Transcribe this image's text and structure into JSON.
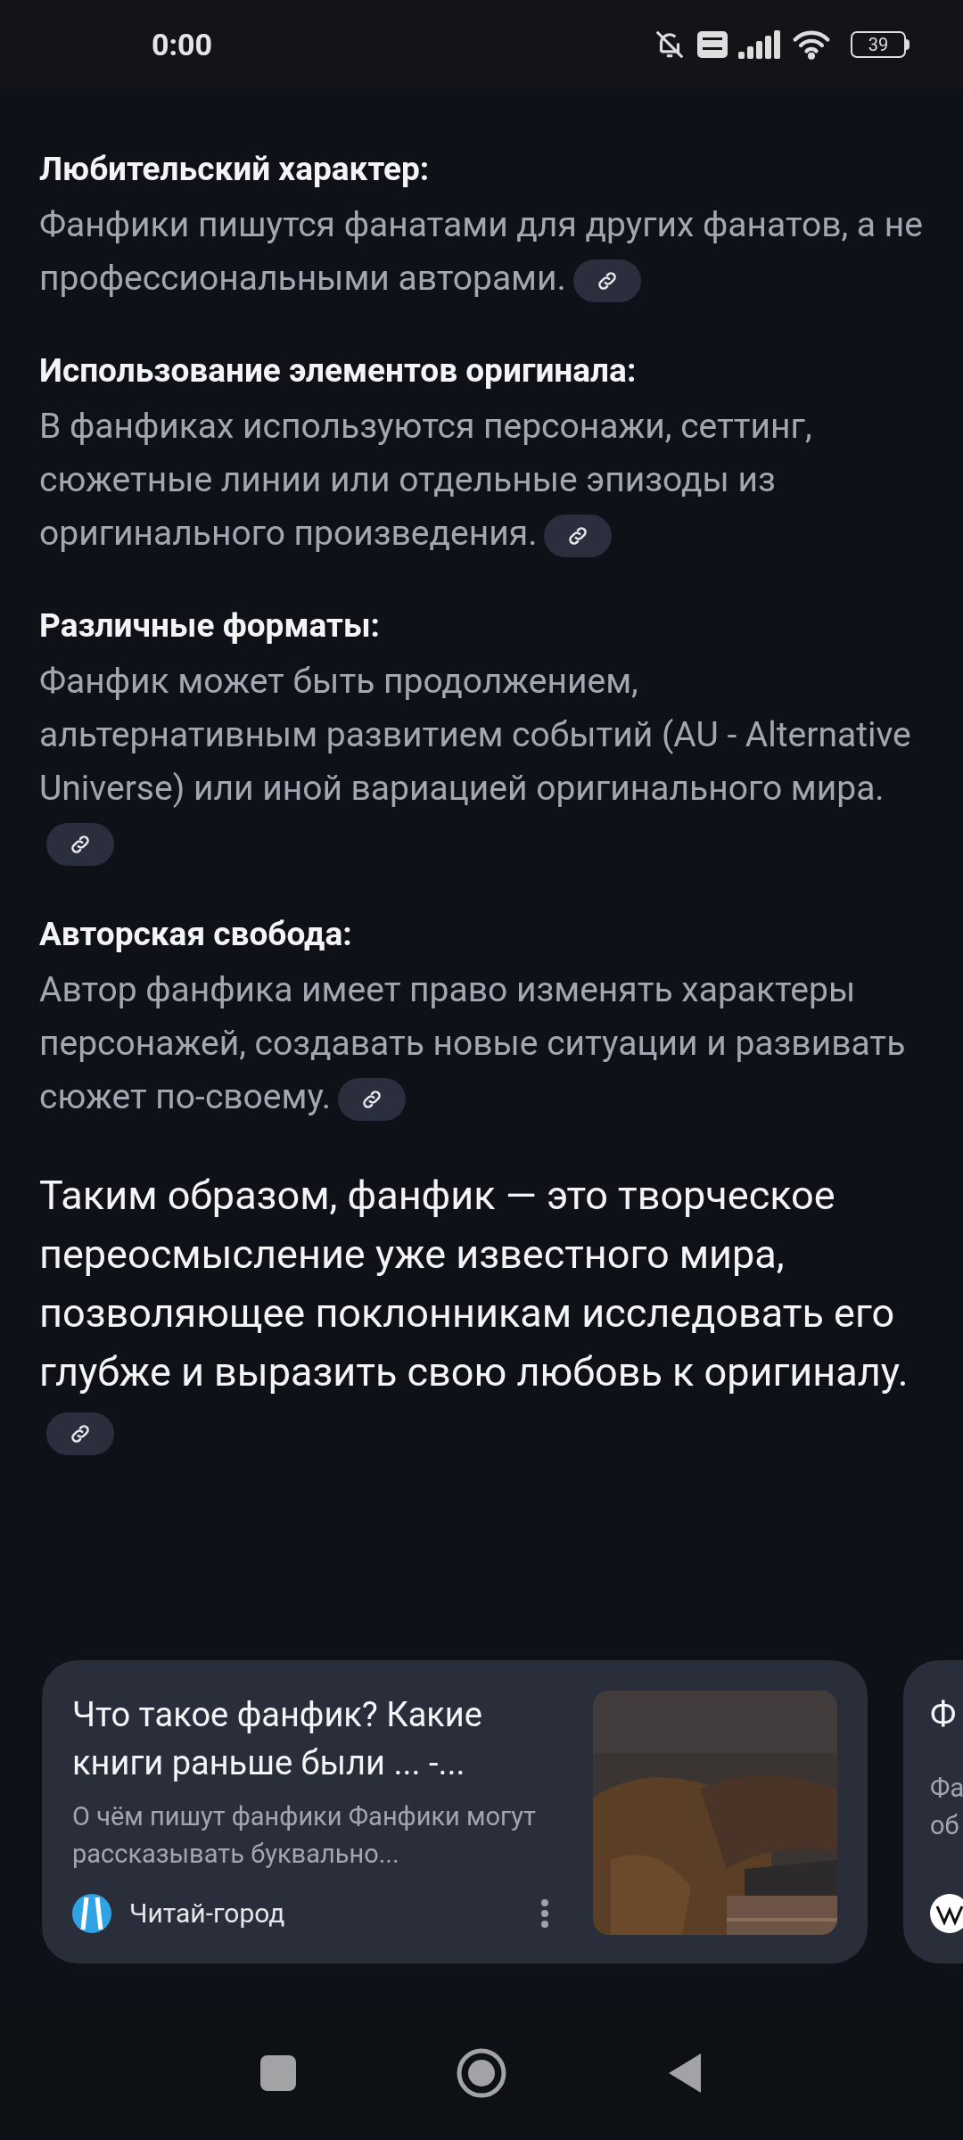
{
  "status_bar": {
    "time": "0:00",
    "battery": "39"
  },
  "sections": [
    {
      "heading": "Любительский характер:",
      "text": "Фанфики пишутся фанатами для других фанатов, а не профессиональными авторами."
    },
    {
      "heading": "Использование элементов оригинала:",
      "text": "В фанфиках используются персонажи, сеттинг, сюжетные линии или отдельные эпизоды из оригинального произведения."
    },
    {
      "heading": "Различные форматы:",
      "text": "Фанфик может быть продолжением, альтернативным развитием событий (AU - Alternative Universe) или иной вариацией оригинального мира."
    },
    {
      "heading": "Авторская свобода:",
      "text": "Автор фанфика имеет право изменять характеры персонажей, создавать новые ситуации и развивать сюжет по-своему."
    }
  ],
  "summary": "Таким образом, фанфик — это творческое переосмысление уже известного мира, позволяющее поклонникам исследовать его глубже и выразить свою любовь к оригиналу.",
  "cards": [
    {
      "title": "Что такое фанфик? Какие книги раньше были ... -...",
      "snippet": "О чём пишут фанфики Фанфики могут рассказывать буквально...",
      "source": "Читай-город",
      "kind": "full"
    },
    {
      "title": "Ф",
      "snippet_lines": [
        "Фа",
        "об"
      ],
      "kind": "partial"
    }
  ]
}
